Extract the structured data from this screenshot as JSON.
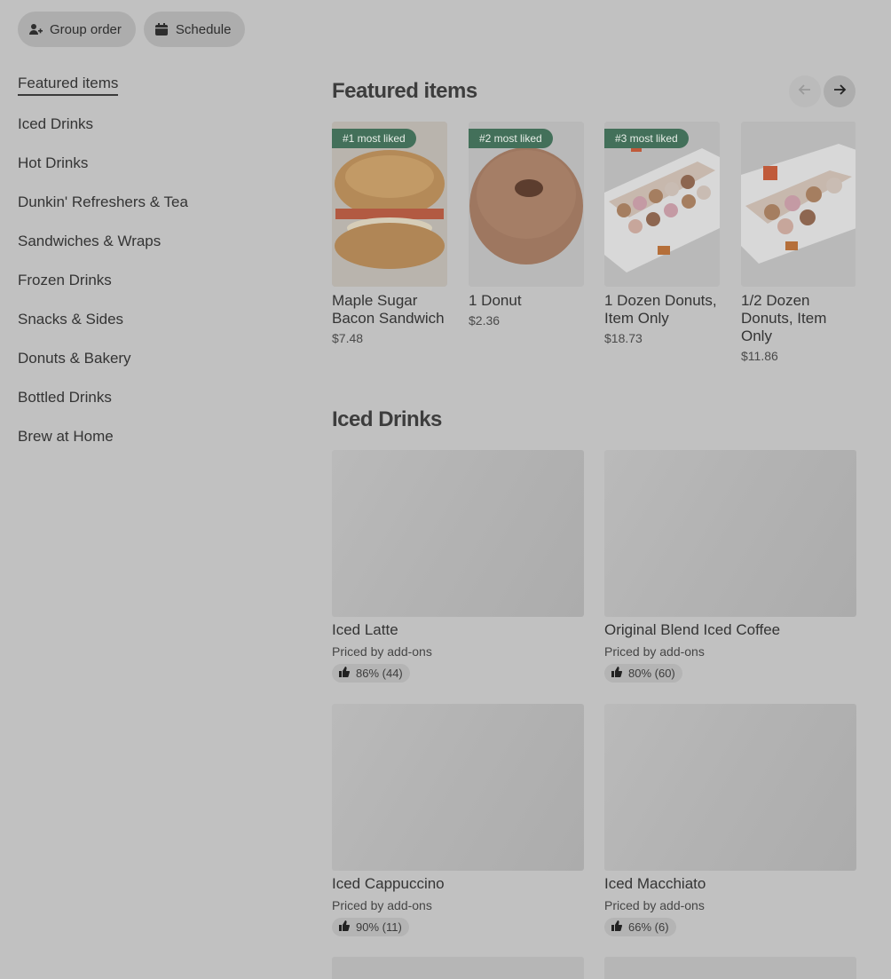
{
  "top_buttons": {
    "group_order": "Group order",
    "schedule": "Schedule"
  },
  "sidebar": {
    "items": [
      {
        "label": "Featured items"
      },
      {
        "label": "Iced Drinks"
      },
      {
        "label": "Hot Drinks"
      },
      {
        "label": "Dunkin' Refreshers & Tea"
      },
      {
        "label": "Sandwiches & Wraps"
      },
      {
        "label": "Frozen Drinks"
      },
      {
        "label": "Snacks & Sides"
      },
      {
        "label": "Donuts & Bakery"
      },
      {
        "label": "Bottled Drinks"
      },
      {
        "label": "Brew at Home"
      }
    ]
  },
  "featured": {
    "title": "Featured items",
    "items": [
      {
        "badge": "#1 most liked",
        "name": "Maple Sugar Bacon Sandwich",
        "price": "$7.48"
      },
      {
        "badge": "#2 most liked",
        "name": "1 Donut",
        "price": "$2.36"
      },
      {
        "badge": "#3 most liked",
        "name": "1 Dozen Donuts, Item Only",
        "price": "$18.73"
      },
      {
        "badge": "",
        "name": "1/2 Dozen Donuts, Item Only",
        "price": "$11.86"
      }
    ]
  },
  "iced_drinks": {
    "title": "Iced Drinks",
    "items": [
      {
        "name": "Iced Latte",
        "sub": "Priced by add-ons",
        "rating": "86% (44)"
      },
      {
        "name": "Original Blend Iced Coffee",
        "sub": "Priced by add-ons",
        "rating": "80% (60)"
      },
      {
        "name": "Iced Cappuccino",
        "sub": "Priced by add-ons",
        "rating": "90% (11)"
      },
      {
        "name": "Iced Macchiato",
        "sub": "Priced by add-ons",
        "rating": "66% (6)"
      }
    ]
  },
  "colors": {
    "badge_green": "#43705a",
    "overlay_gray": "#c1c1c1"
  },
  "icons": [
    "add-user-icon",
    "calendar-icon",
    "arrow-left-icon",
    "arrow-right-icon",
    "thumbs-up-icon"
  ]
}
